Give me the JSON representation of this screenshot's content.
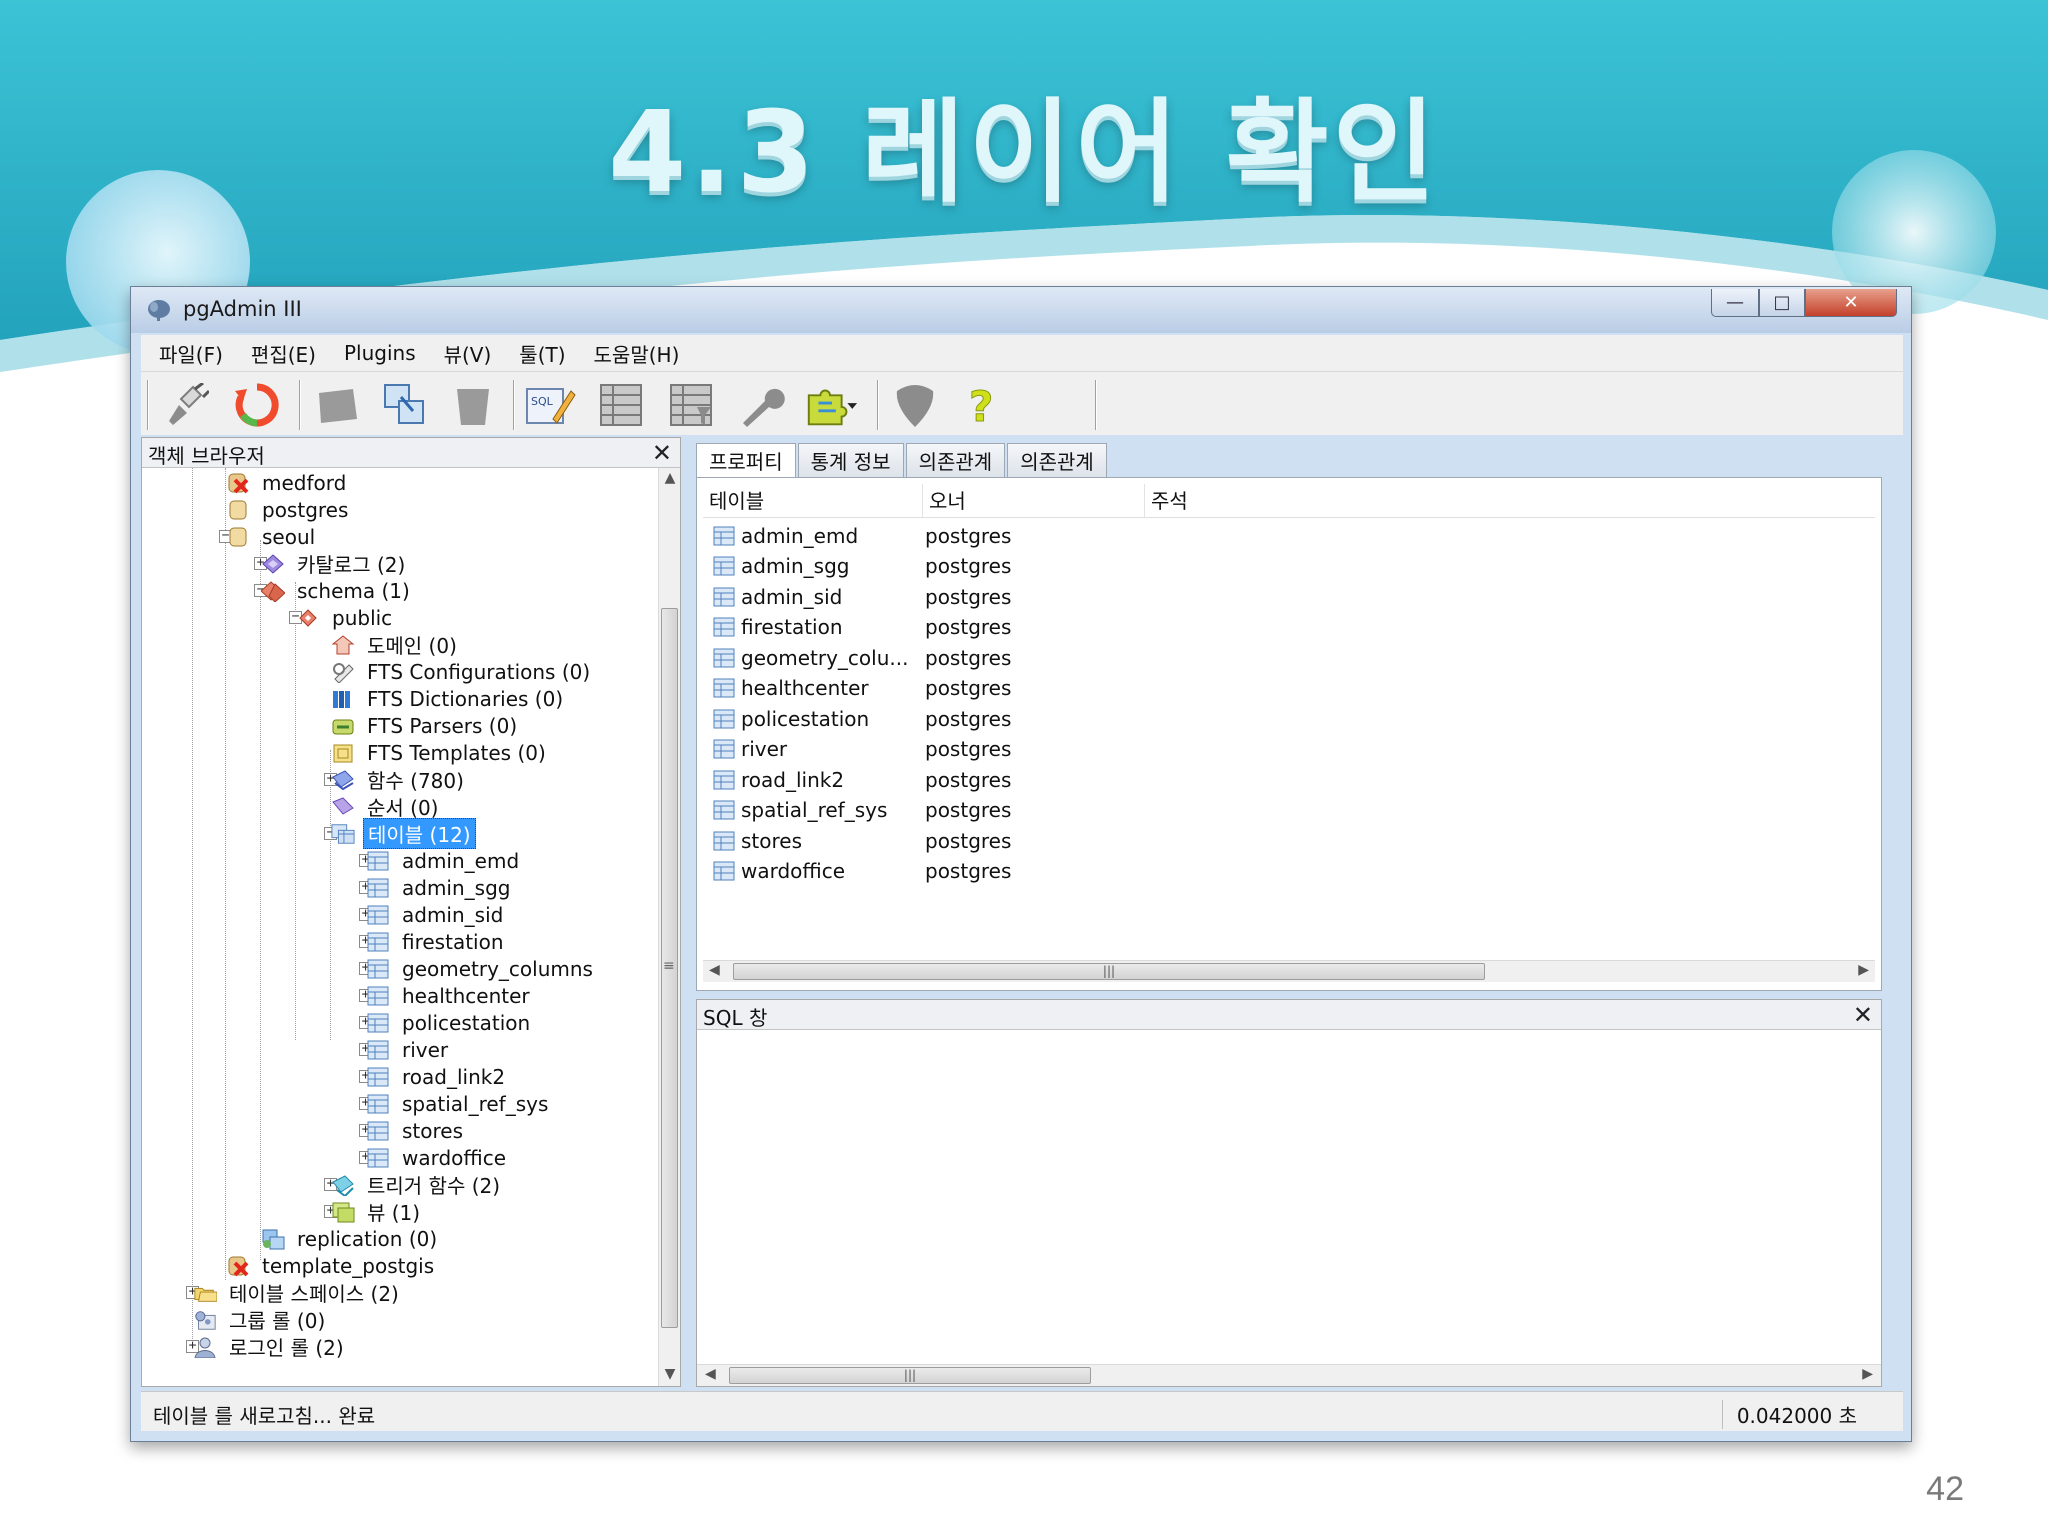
{
  "slide": {
    "title": "4.3 레이어 확인",
    "page_number": "42"
  },
  "window": {
    "title": "pgAdmin III"
  },
  "menu": [
    "파일(F)",
    "편집(E)",
    "Plugins",
    "뷰(V)",
    "툴(T)",
    "도움말(H)"
  ],
  "toolbar_icons": [
    "plug-icon",
    "refresh-icon",
    "properties-icon",
    "object-icon",
    "drop-icon",
    "sql-editor-icon",
    "view-data-icon",
    "filtered-data-icon",
    "maintenance-icon",
    "plugins-icon",
    "guru-icon",
    "help-icon"
  ],
  "object_browser": {
    "title": "객체 브라우저",
    "tree": [
      {
        "label": "medford",
        "icon": "db-error-icon"
      },
      {
        "label": "postgres",
        "icon": "database-icon"
      },
      {
        "label": "seoul",
        "icon": "database-icon"
      },
      {
        "label": "카탈로그 (2)",
        "icon": "catalog-icon"
      },
      {
        "label": "schema (1)",
        "icon": "schemas-icon"
      },
      {
        "label": "public",
        "icon": "schema-icon"
      },
      {
        "label": "도메인 (0)",
        "icon": "domain-icon"
      },
      {
        "label": "FTS Configurations (0)",
        "icon": "fts-config-icon"
      },
      {
        "label": "FTS Dictionaries (0)",
        "icon": "fts-dict-icon"
      },
      {
        "label": "FTS Parsers (0)",
        "icon": "fts-parser-icon"
      },
      {
        "label": "FTS Templates (0)",
        "icon": "fts-template-icon"
      },
      {
        "label": "함수 (780)",
        "icon": "function-icon"
      },
      {
        "label": "순서 (0)",
        "icon": "sequence-icon"
      },
      {
        "label": "테이블 (12)",
        "icon": "tables-icon"
      },
      {
        "label": "admin_emd",
        "icon": "table-icon"
      },
      {
        "label": "admin_sgg",
        "icon": "table-icon"
      },
      {
        "label": "admin_sid",
        "icon": "table-icon"
      },
      {
        "label": "firestation",
        "icon": "table-icon"
      },
      {
        "label": "geometry_columns",
        "icon": "table-icon"
      },
      {
        "label": "healthcenter",
        "icon": "table-icon"
      },
      {
        "label": "policestation",
        "icon": "table-icon"
      },
      {
        "label": "river",
        "icon": "table-icon"
      },
      {
        "label": "road_link2",
        "icon": "table-icon"
      },
      {
        "label": "spatial_ref_sys",
        "icon": "table-icon"
      },
      {
        "label": "stores",
        "icon": "table-icon"
      },
      {
        "label": "wardoffice",
        "icon": "table-icon"
      },
      {
        "label": "트리거 함수 (2)",
        "icon": "trigger-function-icon"
      },
      {
        "label": "뷰 (1)",
        "icon": "view-icon"
      },
      {
        "label": "replication (0)",
        "icon": "replication-icon"
      },
      {
        "label": "template_postgis",
        "icon": "db-error-icon"
      },
      {
        "label": "테이블 스페이스 (2)",
        "icon": "tablespace-icon"
      },
      {
        "label": "그룹 롤 (0)",
        "icon": "group-role-icon"
      },
      {
        "label": "로그인 롤 (2)",
        "icon": "login-role-icon"
      }
    ]
  },
  "tabs": [
    "프로퍼티",
    "통계 정보",
    "의존관계",
    "의존관계"
  ],
  "properties": {
    "columns": [
      "테이블",
      "오너",
      "주석"
    ],
    "rows": [
      [
        "admin_emd",
        "postgres"
      ],
      [
        "admin_sgg",
        "postgres"
      ],
      [
        "admin_sid",
        "postgres"
      ],
      [
        "firestation",
        "postgres"
      ],
      [
        "geometry_colu...",
        "postgres"
      ],
      [
        "healthcenter",
        "postgres"
      ],
      [
        "policestation",
        "postgres"
      ],
      [
        "river",
        "postgres"
      ],
      [
        "road_link2",
        "postgres"
      ],
      [
        "spatial_ref_sys",
        "postgres"
      ],
      [
        "stores",
        "postgres"
      ],
      [
        "wardoffice",
        "postgres"
      ]
    ]
  },
  "sql_pane": {
    "title": "SQL 창"
  },
  "status": {
    "text": "테이블 를 새로고침... 완료",
    "time": "0.042000 초"
  }
}
